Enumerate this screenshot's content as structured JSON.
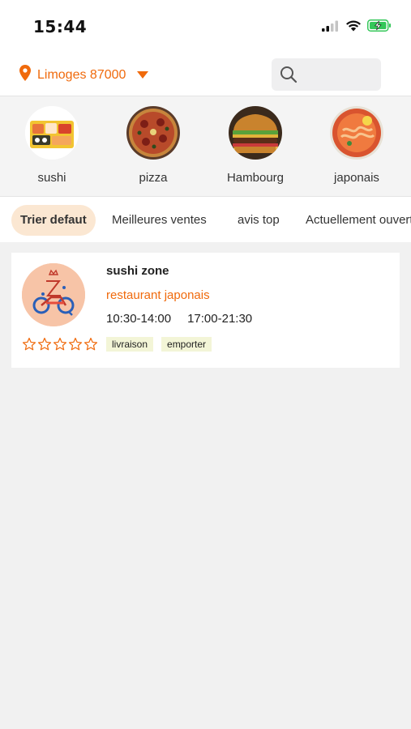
{
  "status_bar": {
    "time": "15:44"
  },
  "header": {
    "location_label": "Limoges 87000",
    "search_placeholder": ""
  },
  "categories": [
    {
      "label": "sushi",
      "icon": "sushi-image"
    },
    {
      "label": "pizza",
      "icon": "pizza-image"
    },
    {
      "label": "Hambourg",
      "icon": "burger-image"
    },
    {
      "label": "japonais",
      "icon": "japanese-dish-image"
    }
  ],
  "sort_options": [
    {
      "label": "Trier defaut",
      "active": true
    },
    {
      "label": "Meilleures ventes",
      "active": false
    },
    {
      "label": "avis top",
      "active": false
    },
    {
      "label": "Actuellement ouvert",
      "active": false
    }
  ],
  "restaurant": {
    "name": "sushi zone",
    "type": "restaurant japonais",
    "hours": [
      "10:30-14:00",
      "17:00-21:30"
    ],
    "rating_stars": 0,
    "rating_max": 5,
    "tags": [
      "livraison",
      "emporter"
    ]
  },
  "colors": {
    "accent": "#f06a0c",
    "active_chip_bg": "#fbe7d2",
    "tag_bg": "#f3f5d7",
    "page_bg": "#f1f1f1"
  }
}
